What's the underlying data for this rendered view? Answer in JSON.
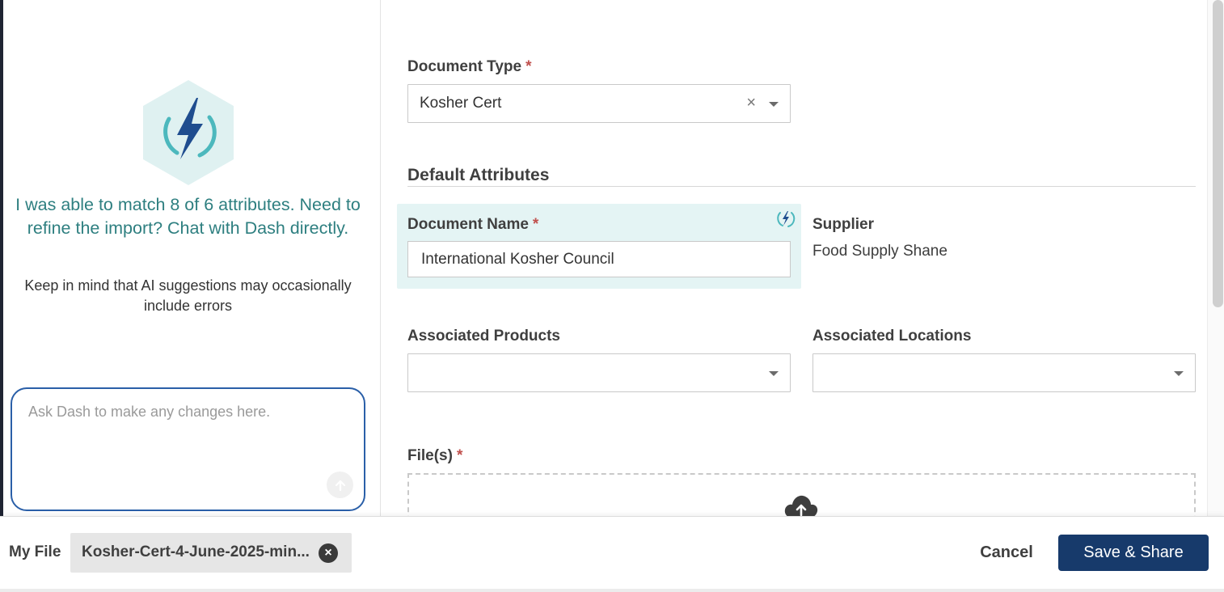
{
  "assistant": {
    "icon": "lightning-bolt-icon",
    "message": "I was able to match 8 of 6 attributes. Need to refine the import? Chat with Dash directly.",
    "disclaimer": "Keep in mind that AI suggestions may occasionally include errors",
    "chat_placeholder": "Ask Dash to make any changes here.",
    "send_icon": "arrow-up-icon"
  },
  "form": {
    "document_type": {
      "label": "Document Type",
      "required_mark": "*",
      "value": "Kosher Cert"
    },
    "section_title": "Default Attributes",
    "document_name": {
      "label": "Document Name",
      "required_mark": "*",
      "value": "International Kosher Council",
      "ai_icon": "ai-suggestion-icon"
    },
    "supplier": {
      "label": "Supplier",
      "value": "Food Supply Shane"
    },
    "associated_products": {
      "label": "Associated Products",
      "value": ""
    },
    "associated_locations": {
      "label": "Associated Locations",
      "value": ""
    },
    "files": {
      "label": "File(s)",
      "required_mark": "*",
      "upload_icon": "cloud-upload-icon"
    }
  },
  "footer": {
    "my_file_label": "My File",
    "file_name": "Kosher-Cert-4-June-2025-min...",
    "remove_icon": "close-circle-icon",
    "cancel_label": "Cancel",
    "save_label": "Save & Share"
  },
  "colors": {
    "accent_teal": "#2e7f80",
    "highlight_bg": "#e4f4f4",
    "primary_button": "#173a6b",
    "chat_border": "#2a5fa8",
    "required": "#c0504d"
  }
}
